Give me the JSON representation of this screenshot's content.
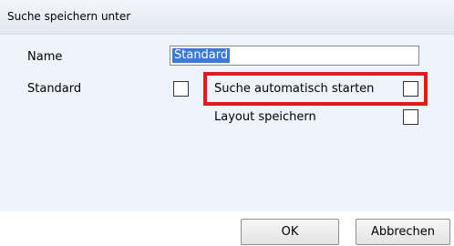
{
  "dialog": {
    "title": "Suche speichern unter",
    "name_label": "Name",
    "name_value": "Standard",
    "standard_label": "Standard",
    "auto_search_label": "Suche automatisch starten",
    "layout_label": "Layout speichern",
    "ok_label": "OK",
    "cancel_label": "Abbrechen",
    "highlight_color": "#e01b1b",
    "selection_color": "#3b78d8"
  }
}
